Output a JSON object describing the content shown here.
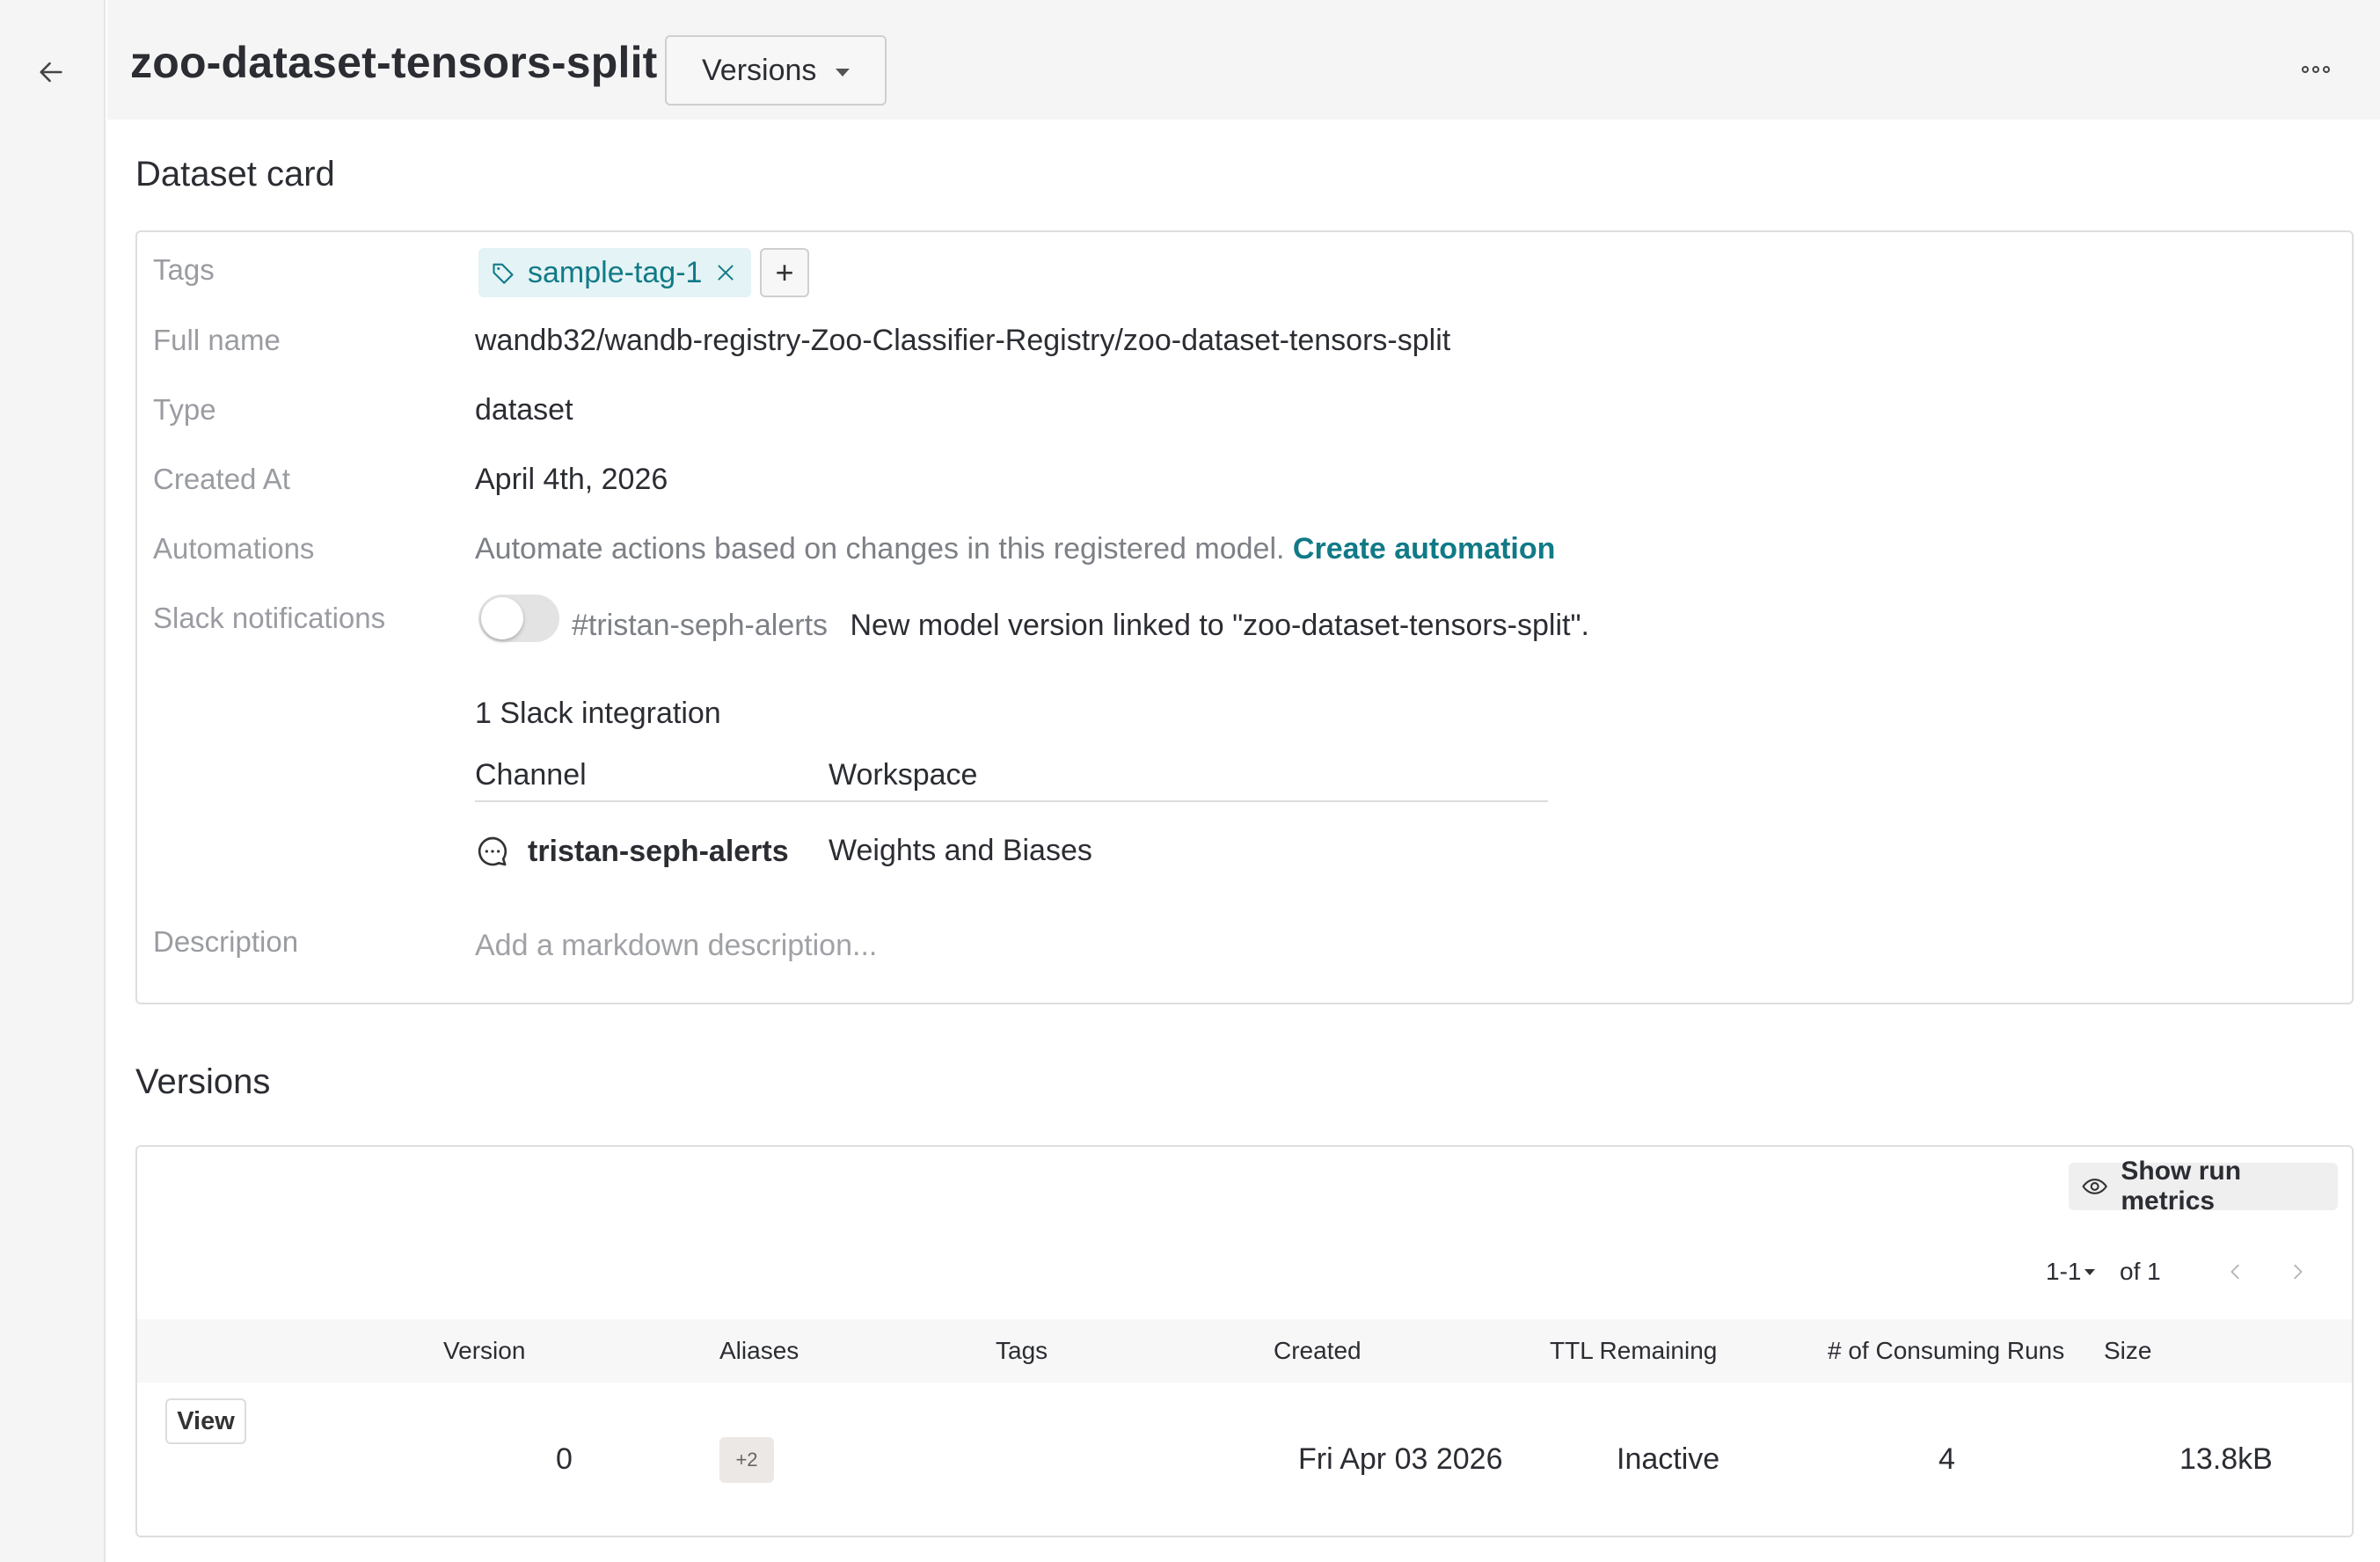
{
  "header": {
    "title": "zoo-dataset-tensors-split",
    "versions_dropdown": "Versions",
    "back_icon": "arrow-left-icon",
    "more_icon": "ellipsis-icon"
  },
  "dataset_card": {
    "section_title": "Dataset card",
    "tags": {
      "label": "Tags",
      "items": [
        "sample-tag-1"
      ],
      "add_label": "+"
    },
    "full_name": {
      "label": "Full name",
      "value": "wandb32/wandb-registry-Zoo-Classifier-Registry/zoo-dataset-tensors-split"
    },
    "type": {
      "label": "Type",
      "value": "dataset"
    },
    "created_at": {
      "label": "Created At",
      "value": "April 4th, 2026"
    },
    "automations": {
      "label": "Automations",
      "text": "Automate actions based on changes in this registered model.",
      "link": "Create automation"
    },
    "slack": {
      "label": "Slack notifications",
      "enabled": false,
      "channel": "#tristan-seph-alerts",
      "message": "New model version linked to \"zoo-dataset-tensors-split\".",
      "integration_count": "1 Slack integration",
      "columns": [
        "Channel",
        "Workspace"
      ],
      "rows": [
        {
          "channel": "tristan-seph-alerts",
          "workspace": "Weights and Biases"
        }
      ]
    },
    "description": {
      "label": "Description",
      "placeholder": "Add a markdown description..."
    }
  },
  "versions": {
    "section_title": "Versions",
    "show_metrics_label": "Show run metrics",
    "pager": {
      "range": "1-1",
      "of": "of 1"
    },
    "columns": [
      "Version",
      "Aliases",
      "Tags",
      "Created",
      "TTL Remaining",
      "# of Consuming Runs",
      "Size"
    ],
    "rows": [
      {
        "action": "View",
        "version": "0",
        "aliases_badge": "+2",
        "tags": "",
        "created": "Fri Apr 03 2026",
        "ttl": "Inactive",
        "consuming_runs": "4",
        "size": "13.8kB"
      }
    ]
  },
  "colors": {
    "accent_teal": "#117a87",
    "tag_bg": "#e4f3f5",
    "header_bg": "#f5f5f5"
  }
}
